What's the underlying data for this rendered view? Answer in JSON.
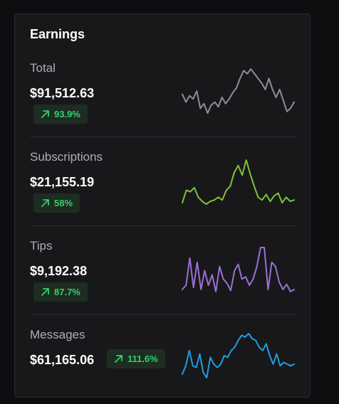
{
  "card": {
    "title": "Earnings",
    "rows": [
      {
        "label": "Total",
        "value": "$91,512.63",
        "change": "93.9%",
        "color": "#8e8e96",
        "trend": "up",
        "spark": [
          14,
          9,
          13,
          11,
          16,
          5,
          8,
          2,
          7,
          9,
          6,
          12,
          8,
          11,
          15,
          18,
          24,
          29,
          27,
          30,
          27,
          24,
          21,
          17,
          24,
          17,
          12,
          17,
          10,
          3,
          5,
          9
        ]
      },
      {
        "label": "Subscriptions",
        "value": "$21,155.19",
        "change": "58%",
        "color": "#7cc43a",
        "trend": "up",
        "spark": [
          4,
          13,
          12,
          15,
          8,
          5,
          3,
          5,
          6,
          8,
          6,
          13,
          16,
          26,
          31,
          24,
          35,
          25,
          16,
          8,
          6,
          10,
          5,
          9,
          11,
          4,
          8,
          5,
          6
        ]
      },
      {
        "label": "Tips",
        "value": "$9,192.38",
        "change": "87.7%",
        "color": "#9c6fd4",
        "trend": "up",
        "spark": [
          8,
          12,
          38,
          10,
          34,
          8,
          26,
          12,
          22,
          6,
          30,
          18,
          14,
          7,
          26,
          32,
          18,
          20,
          12,
          18,
          30,
          48,
          48,
          8,
          34,
          30,
          15,
          8,
          13,
          6,
          8
        ]
      },
      {
        "label": "Messages",
        "value": "$61,165.06",
        "change": "111.6%",
        "color": "#1e9ee0",
        "trend": "up",
        "spark": [
          4,
          9,
          18,
          9,
          8,
          16,
          5,
          2,
          14,
          10,
          8,
          10,
          15,
          14,
          18,
          20,
          24,
          27,
          26,
          28,
          25,
          24,
          20,
          18,
          22,
          15,
          10,
          16,
          9,
          11,
          10,
          9,
          10
        ]
      }
    ]
  }
}
